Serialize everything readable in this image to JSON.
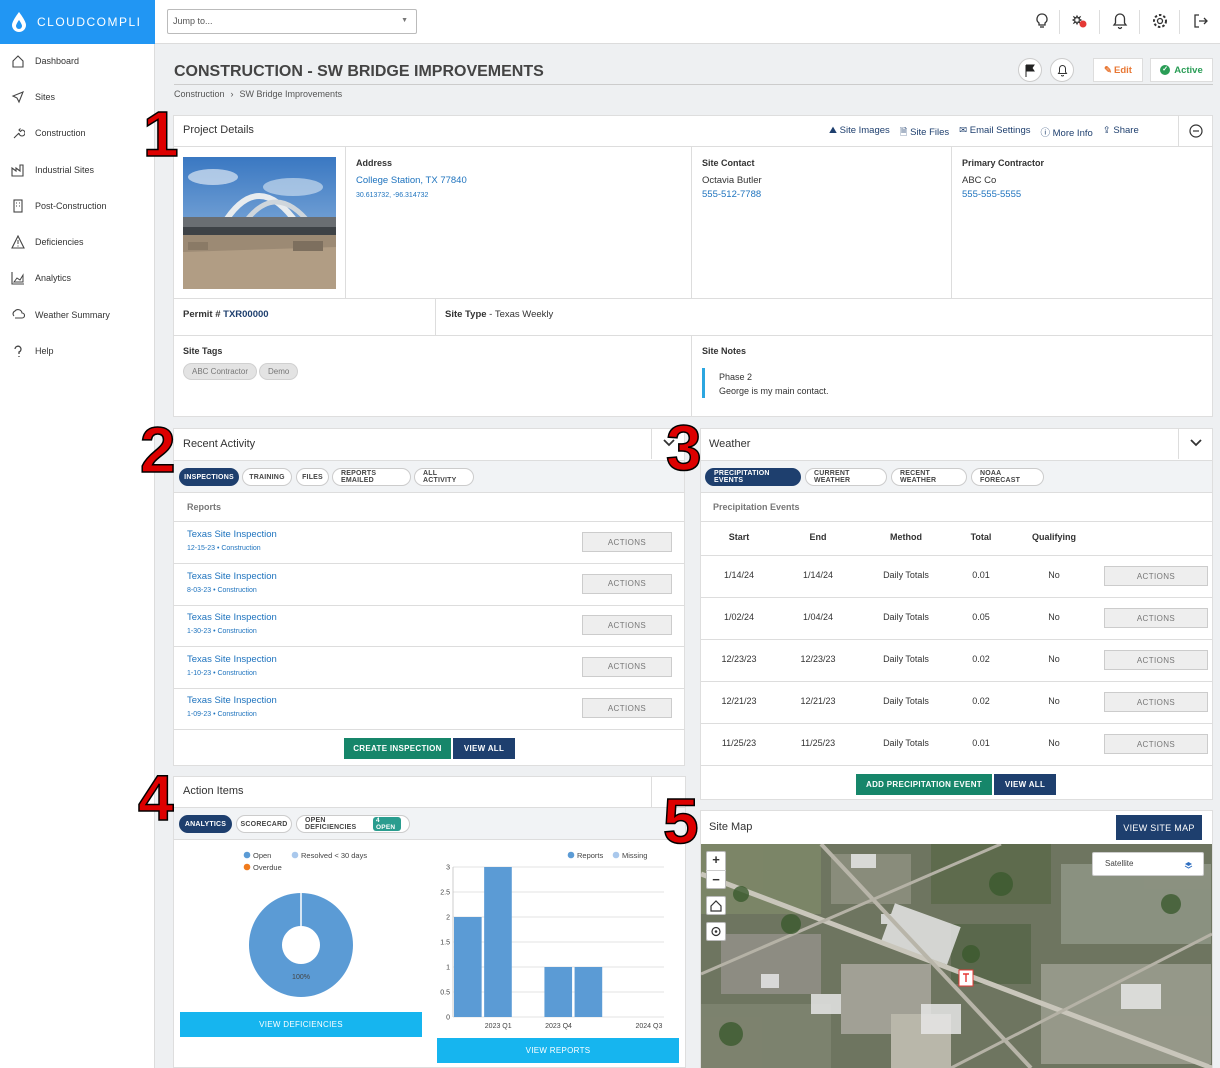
{
  "brand": {
    "name": "CLOUDCOMPLI",
    "color": "#2196f3"
  },
  "sidebar": {
    "items": [
      {
        "label": "Dashboard",
        "icon": "home-icon"
      },
      {
        "label": "Sites",
        "icon": "location-arrow-icon"
      },
      {
        "label": "Construction",
        "icon": "wrench-icon"
      },
      {
        "label": "Industrial Sites",
        "icon": "industry-icon"
      },
      {
        "label": "Post-Construction",
        "icon": "building-icon"
      },
      {
        "label": "Deficiencies",
        "icon": "warning-icon"
      },
      {
        "label": "Analytics",
        "icon": "chart-area-icon"
      },
      {
        "label": "Weather Summary",
        "icon": "cloud-rain-icon"
      },
      {
        "label": "Help",
        "icon": "question-icon"
      }
    ]
  },
  "topbar": {
    "jump_placeholder": "Jump to...",
    "icons": [
      "lightbulb-icon",
      "magic-icon",
      "bell-icon",
      "gear-icon",
      "logout-icon"
    ]
  },
  "page": {
    "title": "CONSTRUCTION - SW BRIDGE IMPROVEMENTS",
    "breadcrumb": [
      "Construction",
      "SW Bridge Improvements"
    ],
    "edit_label": "Edit",
    "status_label": "Active"
  },
  "project": {
    "title": "Project Details",
    "actions": [
      "Site Images",
      "Site Files",
      "Email Settings",
      "More Info",
      "Share"
    ],
    "address_label": "Address",
    "address": "College Station, TX 77840",
    "coords": "30.613732, -96.314732",
    "contact_label": "Site Contact",
    "contact_name": "Octavia Butler",
    "contact_phone": "555-512-7788",
    "contractor_label": "Primary Contractor",
    "contractor_name": "ABC Co",
    "contractor_phone": "555-555-5555",
    "permit_label": "Permit #",
    "permit": "TXR00000",
    "site_type_label": "Site Type",
    "site_type": "Texas Weekly",
    "tags_label": "Site Tags",
    "tags": [
      "ABC Contractor",
      "Demo"
    ],
    "notes_label": "Site Notes",
    "notes": [
      "Phase 2",
      "George is my main contact."
    ]
  },
  "activity": {
    "title": "Recent Activity",
    "tabs": [
      "INSPECTIONS",
      "TRAINING",
      "FILES",
      "REPORTS EMAILED",
      "ALL ACTIVITY"
    ],
    "section": "Reports",
    "rows": [
      {
        "title": "Texas Site Inspection",
        "sub": "12-15-23 • Construction"
      },
      {
        "title": "Texas Site Inspection",
        "sub": "8-03-23 • Construction"
      },
      {
        "title": "Texas Site Inspection",
        "sub": "1-30-23 • Construction"
      },
      {
        "title": "Texas Site Inspection",
        "sub": "1-10-23 • Construction"
      },
      {
        "title": "Texas Site Inspection",
        "sub": "1-09-23 • Construction"
      }
    ],
    "actions_label": "ACTIONS",
    "create_label": "CREATE INSPECTION",
    "view_all_label": "VIEW ALL"
  },
  "weather": {
    "title": "Weather",
    "tabs": [
      "PRECIPITATION EVENTS",
      "CURRENT WEATHER",
      "RECENT WEATHER",
      "NOAA FORECAST"
    ],
    "section": "Precipitation Events",
    "columns": [
      "Start",
      "End",
      "Method",
      "Total",
      "Qualifying"
    ],
    "rows": [
      [
        "1/14/24",
        "1/14/24",
        "Daily Totals",
        "0.01",
        "No"
      ],
      [
        "1/02/24",
        "1/04/24",
        "Daily Totals",
        "0.05",
        "No"
      ],
      [
        "12/23/23",
        "12/23/23",
        "Daily Totals",
        "0.02",
        "No"
      ],
      [
        "12/21/23",
        "12/21/23",
        "Daily Totals",
        "0.02",
        "No"
      ],
      [
        "11/25/23",
        "11/25/23",
        "Daily Totals",
        "0.01",
        "No"
      ]
    ],
    "actions_label": "ACTIONS",
    "add_label": "ADD PRECIPITATION EVENT",
    "view_all_label": "VIEW ALL"
  },
  "action_items": {
    "title": "Action Items",
    "tabs": [
      "ANALYTICS",
      "SCORECARD",
      "OPEN DEFICIENCIES"
    ],
    "open_badge": "4 OPEN",
    "view_def_label": "VIEW DEFICIENCIES",
    "view_reports_label": "VIEW REPORTS"
  },
  "site_map": {
    "title": "Site Map",
    "button": "VIEW SITE MAP",
    "layer_label": "Satellite",
    "controls": [
      "+",
      "−"
    ]
  },
  "annotations": [
    "1",
    "2",
    "3",
    "4",
    "5"
  ],
  "chart_data": [
    {
      "type": "pie",
      "legend": [
        "Open",
        "Resolved < 30 days",
        "Overdue"
      ],
      "colors": [
        "#5b9bd5",
        "#a9c8ec",
        "#f07b1d"
      ],
      "values": [
        100,
        0,
        0
      ],
      "slice_label": "100%",
      "legend_position": "top"
    },
    {
      "type": "bar",
      "legend": [
        "Reports",
        "Missing"
      ],
      "colors": [
        "#5b9bd5",
        "#a9c8ec"
      ],
      "categories": [
        "",
        "2023 Q1",
        "",
        "2023 Q4",
        "",
        "",
        "2024 Q3"
      ],
      "series": [
        {
          "name": "Reports",
          "values": [
            2,
            3,
            0,
            1,
            1,
            0,
            0
          ]
        }
      ],
      "ylim": [
        0,
        3
      ],
      "yticks": [
        "0",
        "0.5",
        "1",
        "1.5",
        "2",
        "2.5",
        "3"
      ],
      "xticks_shown": [
        "2023 Q1",
        "2023 Q4",
        "2024 Q3"
      ],
      "legend_position": "top-right",
      "grid": true
    }
  ]
}
